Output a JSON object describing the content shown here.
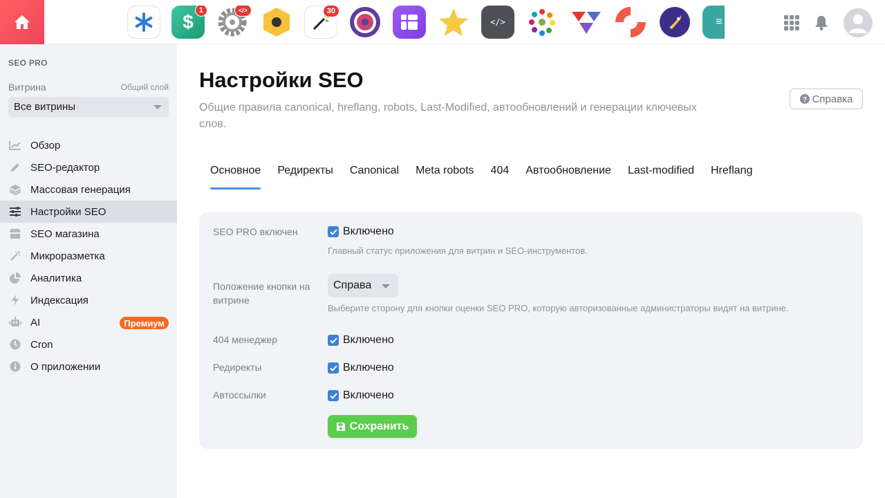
{
  "topbar": {
    "apps": [
      {
        "icon": "asterisk-app-icon",
        "badge": ""
      },
      {
        "icon": "dollar-app-icon",
        "badge": "1"
      },
      {
        "icon": "gear-app-icon",
        "badge": "</>"
      },
      {
        "icon": "hexagon-app-icon",
        "badge": ""
      },
      {
        "icon": "magic-wand-app-icon",
        "badge": "30"
      },
      {
        "icon": "camera-lens-app-icon",
        "badge": ""
      },
      {
        "icon": "blocks-app-icon",
        "badge": ""
      },
      {
        "icon": "star-person-app-icon",
        "badge": ""
      },
      {
        "icon": "code-notebook-app-icon",
        "badge": ""
      },
      {
        "icon": "color-dots-app-icon",
        "badge": ""
      },
      {
        "icon": "triangles-app-icon",
        "badge": ""
      },
      {
        "icon": "lifebuoy-app-icon",
        "badge": ""
      },
      {
        "icon": "rocket-app-icon",
        "badge": ""
      },
      {
        "icon": "teal-app-icon",
        "badge": ""
      }
    ]
  },
  "sidebar": {
    "app_name": "SEO PRO",
    "storefront_label": "Витрина",
    "storefront_hint": "Общий слой",
    "storefront_value": "Все витрины",
    "items": [
      {
        "label": "Обзор"
      },
      {
        "label": "SEO-редактор"
      },
      {
        "label": "Массовая генерация"
      },
      {
        "label": "Настройки SEO"
      },
      {
        "label": "SEO магазина"
      },
      {
        "label": "Микроразметка"
      },
      {
        "label": "Аналитика"
      },
      {
        "label": "Индексация"
      },
      {
        "label": "AI",
        "badge": "Премиум"
      },
      {
        "label": "Cron"
      },
      {
        "label": "О приложении"
      }
    ]
  },
  "main": {
    "title": "Настройки SEO",
    "description": "Общие правила canonical, hreflang, robots, Last-Modified, автообновлений и генерации ключевых слов.",
    "help_label": "Справка",
    "tabs": [
      {
        "label": "Основное"
      },
      {
        "label": "Редиректы"
      },
      {
        "label": "Canonical"
      },
      {
        "label": "Meta robots"
      },
      {
        "label": "404"
      },
      {
        "label": "Автообновление"
      },
      {
        "label": "Last-modified"
      },
      {
        "label": "Hreflang"
      }
    ],
    "form": {
      "seo_pro": {
        "label": "SEO PRO включен",
        "value": "Включено",
        "hint": "Главный статус приложения для витрин и SEO-инструментов."
      },
      "button_position": {
        "label": "Положение кнопки на витрине",
        "value": "Справа",
        "hint": "Выберите сторону для кнопки оценки SEO PRO, которую авторизованные администраторы видят на витрине."
      },
      "manager_404": {
        "label": "404 менеджер",
        "value": "Включено"
      },
      "redirects": {
        "label": "Редиректы",
        "value": "Включено"
      },
      "autolinks": {
        "label": "Автоссылки",
        "value": "Включено"
      },
      "save_label": "Сохранить"
    }
  },
  "colors": {
    "accent": "#4a90e2",
    "save": "#5ccc4e",
    "premium": "#f16a26",
    "home": "#f0465b"
  }
}
